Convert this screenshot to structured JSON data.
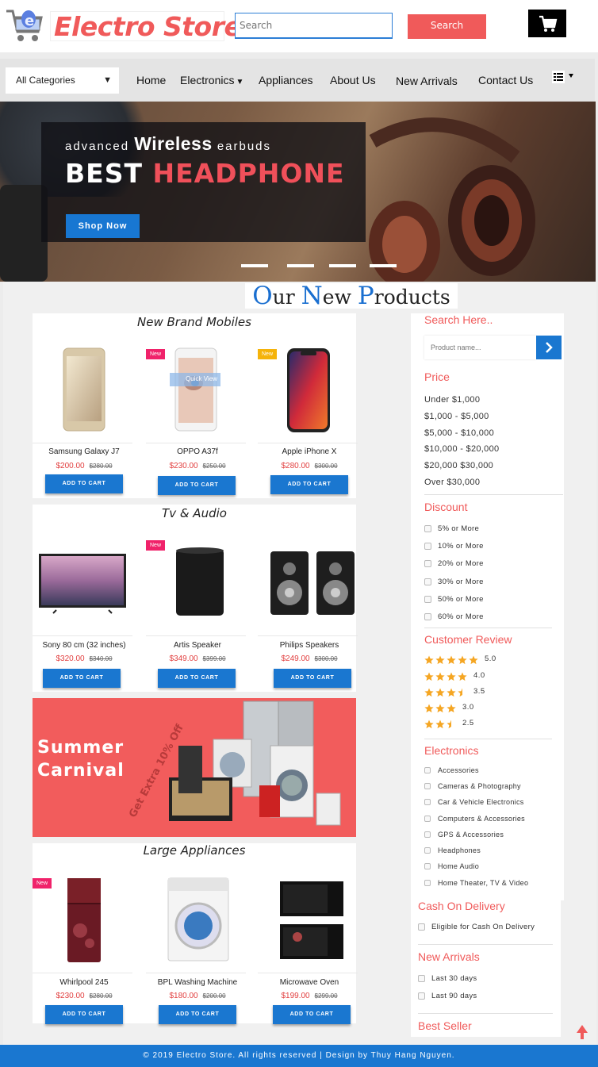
{
  "header": {
    "brand": "Electro Store",
    "search_placeholder": "Search",
    "search_button": "Search"
  },
  "nav": {
    "category_select": "All Categories",
    "links": [
      "Home",
      "Electronics",
      "Appliances",
      "About Us",
      "New Arrivals",
      "Contact Us"
    ]
  },
  "hero": {
    "small_prefix": "advanced",
    "small_bold": "Wireless",
    "small_suffix": "earbuds",
    "title_main": "BEST",
    "title_highlight": "HEADPHONE",
    "cta": "Shop Now",
    "slides": 4
  },
  "section_title": {
    "c1": "O",
    "t1": "ur ",
    "c2": "N",
    "t2": "ew ",
    "c3": "P",
    "t3": "roducts"
  },
  "panels": [
    {
      "title": "New Brand Mobiles",
      "products": [
        {
          "name": "Samsung Galaxy J7",
          "price": "$200.00",
          "old_price": "$280.00",
          "badge": ""
        },
        {
          "name": "OPPO A37f",
          "price": "$230.00",
          "old_price": "$250.00",
          "badge": "New",
          "overlay": "Quick View"
        },
        {
          "name": "Apple iPhone X",
          "price": "$280.00",
          "old_price": "$300.00",
          "badge": "New"
        }
      ]
    },
    {
      "title": "Tv & Audio",
      "products": [
        {
          "name": "Sony 80 cm (32 inches)",
          "price": "$320.00",
          "old_price": "$340.00",
          "badge": ""
        },
        {
          "name": "Artis Speaker",
          "price": "$349.00",
          "old_price": "$399.00",
          "badge": "New"
        },
        {
          "name": "Philips Speakers",
          "price": "$249.00",
          "old_price": "$300.00",
          "badge": ""
        }
      ]
    },
    {
      "title": "Large Appliances",
      "products": [
        {
          "name": "Whirlpool 245",
          "price": "$230.00",
          "old_price": "$280.00",
          "badge": "New"
        },
        {
          "name": "BPL Washing Machine",
          "price": "$180.00",
          "old_price": "$200.00",
          "badge": ""
        },
        {
          "name": "Microwave Oven",
          "price": "$199.00",
          "old_price": "$299.00",
          "badge": ""
        }
      ]
    }
  ],
  "add_to_cart": "ADD TO CART",
  "banner": {
    "line1": "Summer",
    "line2": "Carnival",
    "offer": "Get Extra 10% Off"
  },
  "sidebar": {
    "search_title": "Search Here..",
    "search_placeholder": "Product name...",
    "price_title": "Price",
    "price_ranges": [
      "Under $1,000",
      "$1,000 - $5,000",
      "$5,000 - $10,000",
      "$10,000 - $20,000",
      "$20,000 $30,000",
      "Over $30,000"
    ],
    "discount_title": "Discount",
    "discounts": [
      "5% or More",
      "10% or More",
      "20% or More",
      "30% or More",
      "50% or More",
      "60% or More"
    ],
    "review_title": "Customer Review",
    "reviews": [
      {
        "label": "5.0",
        "rating": 5.0
      },
      {
        "label": "4.0",
        "rating": 4.0
      },
      {
        "label": "3.5",
        "rating": 3.5
      },
      {
        "label": "3.0",
        "rating": 3.0
      },
      {
        "label": "2.5",
        "rating": 2.5
      }
    ],
    "electronics_title": "Electronics",
    "electronics": [
      "Accessories",
      "Cameras & Photography",
      "Car & Vehicle Electronics",
      "Computers & Accessories",
      "GPS & Accessories",
      "Headphones",
      "Home Audio",
      "Home Theater, TV & Video"
    ],
    "cod_title": "Cash On Delivery",
    "cod": [
      "Eligible for Cash On Delivery"
    ],
    "arrivals_title": "New Arrivals",
    "arrivals": [
      "Last 30 days",
      "Last 90 days"
    ],
    "bestseller_title": "Best Seller"
  },
  "footer": "© 2019 Electro Store. All rights reserved | Design by Thuy Hang Nguyen.",
  "colors": {
    "accent_red": "#f05a5a",
    "accent_blue": "#1a77d0",
    "badge_pink": "#f0226a",
    "badge_yellow": "#f5b30a",
    "star_gold": "#f5a623"
  }
}
